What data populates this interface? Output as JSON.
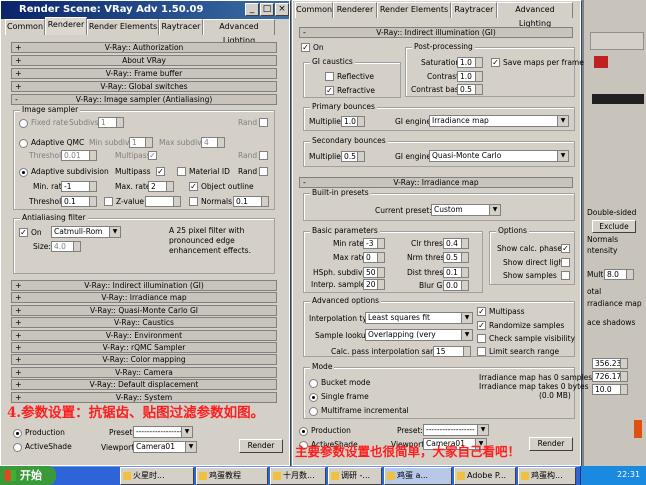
{
  "colors": {
    "desktop": "#6f8fb0",
    "titlebar": "#0a246a",
    "caption": "#ff1e1e",
    "taskbar": "#2f63d8"
  },
  "left": {
    "title": "Render Scene: VRay Adv 1.50.09",
    "tabs": [
      "Common",
      "Renderer",
      "Render Elements",
      "Raytracer",
      "Advanced Lighting"
    ],
    "rollouts_top": [
      "V-Ray:: Authorization",
      "About VRay",
      "V-Ray:: Frame buffer",
      "V-Ray:: Global switches",
      "V-Ray:: Image sampler (Antialiasing)"
    ],
    "image_sampler": {
      "label": "Image sampler",
      "fixed_rate": "Fixed rate",
      "subdivs": "Subdivs:",
      "subdivs_val": "1",
      "rand": "Rand",
      "adaptive_qmc": "Adaptive QMC",
      "min_subdivs": "Min subdivs:",
      "min_subdivs_val": "1",
      "max_subdivs": "Max subdivs:",
      "max_subdivs_val": "4",
      "threshold": "Threshold:",
      "threshold_val": "0.01",
      "multipass": "Multipass",
      "adaptive_subdivision": "Adaptive subdivision",
      "min_rate": "Min. rate:",
      "min_rate_val": "-1",
      "max_rate": "Max. rate:",
      "max_rate_val": "2",
      "material_id": "Material ID",
      "object_outline": "Object outline",
      "threshold2_val": "0.1",
      "z_value": "Z-value",
      "normals": "Normals",
      "normals_val": "0.1"
    },
    "aa_filter": {
      "label": "Antialiasing filter",
      "on": "On",
      "filter": "Catmull-Rom",
      "size": "Size:",
      "size_val": "4.0",
      "desc": "A 25 pixel filter with pronounced edge enhancement effects."
    },
    "rollouts_bottom": [
      "V-Ray:: Indirect illumination (GI)",
      "V-Ray:: Irradiance map",
      "V-Ray:: Quasi-Monte Carlo GI",
      "V-Ray:: Caustics",
      "V-Ray:: Environment",
      "V-Ray:: rQMC Sampler",
      "V-Ray:: Color mapping",
      "V-Ray:: Camera",
      "V-Ray:: Default displacement",
      "V-Ray:: System"
    ],
    "caption": "4.参数设置：抗锯齿、贴图过滤参数如图。",
    "production": "Production",
    "activeshade": "ActiveShade",
    "preset": "Preset:",
    "preset_val": "-----------------",
    "viewport": "Viewport:",
    "viewport_val": "Camera01",
    "render": "Render"
  },
  "right": {
    "tabs": [
      "Common",
      "Renderer",
      "Render Elements",
      "Raytracer",
      "Advanced Lighting"
    ],
    "gi_rollout": "V-Ray:: Indirect illumination (GI)",
    "on": "On",
    "gi_caustics": "GI caustics",
    "reflective": "Reflective",
    "refractive": "Refractive",
    "post": "Post-processing",
    "saturation": "Saturation:",
    "saturation_val": "1.0",
    "contrast": "Contrast:",
    "contrast_val": "1.0",
    "contrast_base": "Contrast base:",
    "contrast_base_val": "0.5",
    "save_maps": "Save maps per frame",
    "primary": "Primary bounces",
    "multiplier": "Multiplier:",
    "primary_mult": "1.0",
    "gi_engine": "GI engine:",
    "primary_engine": "Irradiance map",
    "secondary": "Secondary bounces",
    "secondary_mult": "0.5",
    "secondary_engine": "Quasi-Monte Carlo",
    "irr_rollout": "V-Ray:: Irradiance map",
    "builtin": "Built-in presets",
    "current_preset": "Current preset:",
    "current_preset_val": "Custom",
    "basic": "Basic parameters",
    "min_rate": "Min rate:",
    "min_rate_val": "-3",
    "max_rate": "Max rate:",
    "max_rate_val": "0",
    "hsph": "HSph. subdivs:",
    "hsph_val": "50",
    "interp": "Interp. samples:",
    "interp_val": "20",
    "clr": "Clr thresh:",
    "clr_val": "0.4",
    "nrm": "Nrm thresh:",
    "nrm_val": "0.5",
    "dist": "Dist thresh:",
    "dist_val": "0.1",
    "blur": "Blur GI:",
    "blur_val": "0.0",
    "options": "Options",
    "show_calc": "Show calc. phase",
    "show_direct": "Show direct light",
    "show_samples": "Show samples",
    "advanced": "Advanced options",
    "interp_type": "Interpolation type:",
    "interp_type_val": "Least squares fit (good/smooth",
    "sample_lookup": "Sample lookup:",
    "sample_lookup_val": "Overlapping (very good/fast)",
    "calc_pass": "Calc. pass interpolation samples:",
    "calc_pass_val": "15",
    "multipass": "Multipass",
    "randomize": "Randomize samples",
    "check_vis": "Check sample visibility",
    "limit_search": "Limit search range",
    "mode": "Mode",
    "bucket": "Bucket mode",
    "single": "Single frame",
    "multiframe": "Multiframe incremental",
    "info1": "Irradiance map has 0 samples",
    "info2": "Irradiance map takes 0 bytes",
    "info3": "(0.0 MB)",
    "production": "Production",
    "activeshade": "ActiveShade",
    "preset": "Preset:",
    "preset_val": "------------------",
    "viewport": "Viewport:",
    "viewport_val": "Camera01",
    "render": "Render",
    "caption": "主要参数设置也很简单，大家自己看吧！"
  },
  "bg_panel": {
    "double_sided": "Double-sided",
    "exclude": "Exclude",
    "normals": "Normals",
    "intensity": "ntensity",
    "mult": "Mult.",
    "mult_val": "8.0",
    "total": "otal",
    "irr_map": "rradiance map",
    "face_shadows": "ace shadows",
    "c1": "356.238",
    "c2": "726.177",
    "c3": "10.0"
  },
  "taskbar": {
    "start": "开始",
    "items": [
      "火星时...",
      "鸡蛋教程",
      "十月数...",
      "调研 -...",
      "鸡蛋 a...",
      "Adobe P...",
      "鸡蛋构..."
    ],
    "clock": "22:31"
  }
}
